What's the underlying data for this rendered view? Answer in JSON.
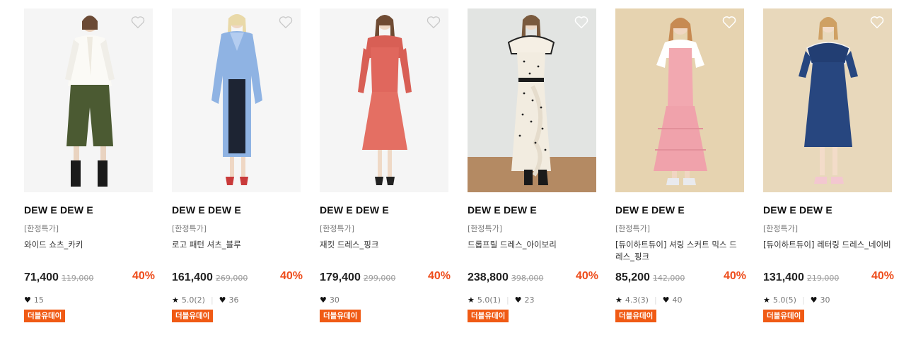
{
  "products": [
    {
      "brand": "DEW E DEW E",
      "promo": "[한정특가]",
      "name": "와이드 쇼츠_카키",
      "price": "71,400",
      "original_price": "119,000",
      "discount": "40%",
      "rating": "",
      "likes": "15",
      "badge": "더블유데이",
      "bg": "#f5f5f5"
    },
    {
      "brand": "DEW E DEW E",
      "promo": "[한정특가]",
      "name": "로고 패턴 셔츠_블루",
      "price": "161,400",
      "original_price": "269,000",
      "discount": "40%",
      "rating": "5.0(2)",
      "likes": "36",
      "badge": "더블유데이",
      "bg": "#f6f6f6"
    },
    {
      "brand": "DEW E DEW E",
      "promo": "[한정특가]",
      "name": "재킷 드레스_핑크",
      "price": "179,400",
      "original_price": "299,000",
      "discount": "40%",
      "rating": "",
      "likes": "30",
      "badge": "더블유데이",
      "bg": "#f5f5f5"
    },
    {
      "brand": "DEW E DEW E",
      "promo": "[한정특가]",
      "name": "드롭프릴 드레스_아이보리",
      "price": "238,800",
      "original_price": "398,000",
      "discount": "40%",
      "rating": "5.0(1)",
      "likes": "23",
      "badge": "더블유데이",
      "bg": "#e2e4e2"
    },
    {
      "brand": "DEW E DEW E",
      "promo": "[한정특가]",
      "name": "[듀이하트듀이] 셔링 스커트 믹스 드레스_핑크",
      "price": "85,200",
      "original_price": "142,000",
      "discount": "40%",
      "rating": "4.3(3)",
      "likes": "40",
      "badge": "더블유데이",
      "bg": "#e6d3b0"
    },
    {
      "brand": "DEW E DEW E",
      "promo": "[한정특가]",
      "name": "[듀이하트듀이] 레터링 드레스_네이비",
      "price": "131,400",
      "original_price": "219,000",
      "discount": "40%",
      "rating": "5.0(5)",
      "likes": "30",
      "badge": "더블유데이",
      "bg": "#e8d8bb"
    }
  ],
  "icons": {
    "wishlist": "heart-outline-icon",
    "likes": "heart-filled-icon",
    "rating": "star-icon"
  }
}
